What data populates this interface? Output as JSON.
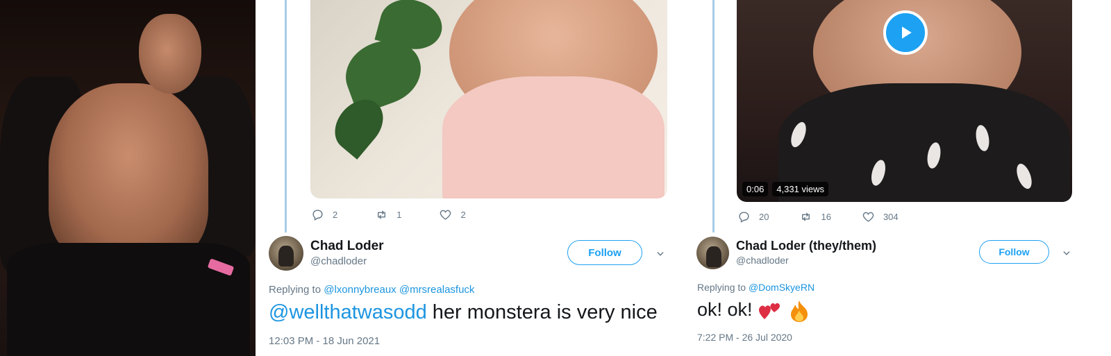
{
  "tweet1": {
    "actions": {
      "replies": "2",
      "retweets": "1",
      "likes": "2"
    },
    "author": {
      "name": "Chad Loder",
      "handle": "@chadloder"
    },
    "follow_label": "Follow",
    "replying_to_prefix": "Replying to",
    "replying_to": [
      "@lxonnybreaux",
      "@mrsrealasfuck"
    ],
    "text_mention": "@wellthatwasodd",
    "text_body": " her monstera is very nice",
    "timestamp": "12:03 PM - 18 Jun 2021"
  },
  "tweet2": {
    "video": {
      "duration": "0:06",
      "views": "4,331 views"
    },
    "actions": {
      "replies": "20",
      "retweets": "16",
      "likes": "304"
    },
    "author": {
      "name": "Chad Loder (they/them)",
      "handle": "@chadloder"
    },
    "follow_label": "Follow",
    "replying_to_prefix": "Replying to",
    "replying_to": [
      "@DomSkyeRN"
    ],
    "text": "ok! ok!",
    "emojis": [
      "two-hearts",
      "fire"
    ],
    "timestamp": "7:22 PM - 26 Jul 2020"
  },
  "colors": {
    "accent": "#1da1f2",
    "link": "#1b95e0",
    "muted": "#657786",
    "text": "#14171a"
  }
}
